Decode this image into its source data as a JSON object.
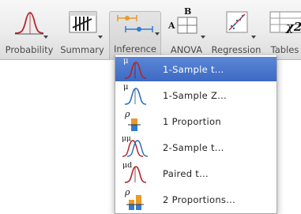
{
  "toolbar": {
    "items": [
      {
        "label": "Probability",
        "icon": "normal-curve-icon"
      },
      {
        "label": "Summary",
        "icon": "tally-marks-icon"
      },
      {
        "label": "Inference",
        "icon": "confidence-intervals-icon",
        "active": true
      },
      {
        "label": "ANOVA",
        "icon": "anova-table-icon",
        "icon_letters": [
          "A",
          "B"
        ]
      },
      {
        "label": "Regression",
        "icon": "scatter-plot-icon"
      },
      {
        "label": "Tables",
        "icon": "chi-square-table-icon",
        "icon_text": "χ2"
      }
    ]
  },
  "menu": {
    "items": [
      {
        "label": "1-Sample t...",
        "icon": "one-sample-t-icon",
        "symbol": "μ",
        "selected": true
      },
      {
        "label": "1-Sample Z...",
        "icon": "one-sample-z-icon",
        "symbol": "μ"
      },
      {
        "label": "1 Proportion",
        "icon": "one-proportion-icon",
        "symbol": "ρ"
      },
      {
        "label": "2-Sample t...",
        "icon": "two-sample-t-icon",
        "symbol": "μμ"
      },
      {
        "label": "Paired t...",
        "icon": "paired-t-icon",
        "symbol": "μd"
      },
      {
        "label": "2 Proportions...",
        "icon": "two-proportions-icon",
        "symbol": "ρ"
      }
    ]
  },
  "colors": {
    "selection": "#3d6ac3",
    "curve_red": "#b0262d",
    "curve_blue": "#2f6fb4",
    "accent_orange": "#e89a2a",
    "accent_blue": "#2f7dd1"
  }
}
